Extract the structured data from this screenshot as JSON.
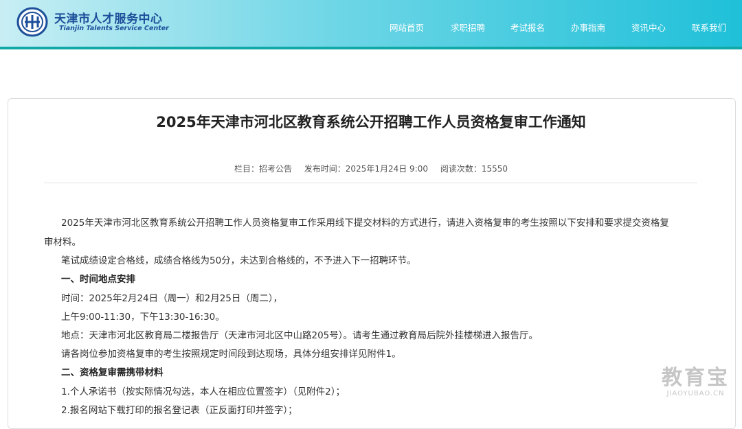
{
  "header": {
    "brand_cn": "天津市人才服务中心",
    "brand_en": "Tianjin Talents Service Center",
    "nav": [
      "网站首页",
      "求职招聘",
      "考试报名",
      "办事指南",
      "资讯中心",
      "联系我们"
    ]
  },
  "article": {
    "title": "2025年天津市河北区教育系统公开招聘工作人员资格复审工作通知",
    "meta": {
      "column": "栏目：招考公告",
      "published": "发布时间：2025年1月24日 9:00",
      "views": "阅读次数：15550"
    },
    "intro_line1": "2025年天津市河北区教育系统公开招聘工作人员资格复审工作采用线下提交材料的方式进行，请进入资格复审的考生按照以下安排和要求提交资格复",
    "intro_line2": "审材料。",
    "score_line": "笔试成绩设定合格线，成绩合格线为50分，未达到合格线的，不予进入下一招聘环节。",
    "section1_heading": "一、时间地点安排",
    "time_line": "时间：2025年2月24日（周一）和2月25日（周二），",
    "hours_line": "上午9:00-11:30，下午13:30-16:30。",
    "location_line": "地点：天津市河北区教育局二楼报告厅（天津市河北区中山路205号）。请考生通过教育局后院外挂楼梯进入报告厅。",
    "arrival_line": "请各岗位参加资格复审的考生按照规定时间段到达现场，具体分组安排详见附件1。",
    "section2_heading": "二、资格复审需携带材料",
    "item1": "1.个人承诺书（按实际情况勾选，本人在相应位置签字）（见附件2）；",
    "item2": "2.报名网站下载打印的报名登记表（正反面打印并签字）；"
  },
  "watermark": {
    "cn": "教育宝",
    "en": "JIAOYUBAO.CN"
  },
  "colors": {
    "header_start": "#c8eef4",
    "header_end": "#1fc0d9",
    "header_line": "#12a8a8",
    "brand": "#1d4f9a"
  }
}
